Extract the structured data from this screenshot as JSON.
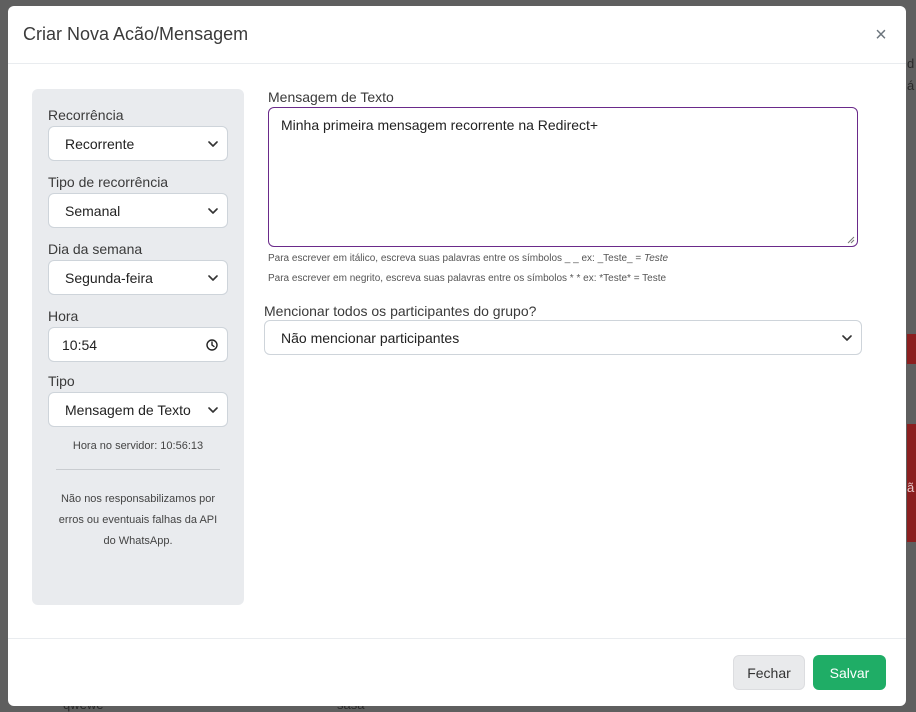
{
  "modal": {
    "title": "Criar Nova Acão/Mensagem",
    "close_symbol": "×"
  },
  "left_panel": {
    "recurrence": {
      "label": "Recorrência",
      "value": "Recorrente"
    },
    "recurrence_type": {
      "label": "Tipo de recorrência",
      "value": "Semanal"
    },
    "weekday": {
      "label": "Dia da semana",
      "value": "Segunda-feira"
    },
    "time": {
      "label": "Hora",
      "value": "10:54"
    },
    "type": {
      "label": "Tipo",
      "value": "Mensagem de Texto"
    },
    "server_time": "Hora no servidor: 10:56:13",
    "disclaimer_line1": "Não nos responsabilizamos por",
    "disclaimer_line2": "erros ou eventuais falhas da API",
    "disclaimer_line3": "do WhatsApp."
  },
  "message": {
    "label": "Mensagem de Texto",
    "value": "Minha primeira mensagem recorrente na Redirect+",
    "hint_italic_prefix": "Para escrever em itálico, escreva suas palavras entre os símbolos _ _ ex: _Teste_ = ",
    "hint_italic_example": "Teste",
    "hint_bold": "Para escrever em negrito, escreva suas palavras entre os símbolos * * ex: *Teste* = Teste"
  },
  "mention": {
    "label": "Mencionar todos os participantes do grupo?",
    "value": "Não mencionar participantes"
  },
  "footer": {
    "close_label": "Fechar",
    "save_label": "Salvar"
  },
  "background": {
    "frag1": "d",
    "frag2": "á",
    "frag3": "ã",
    "frag4": "qwewe",
    "frag5": "sasa"
  },
  "colors": {
    "save_button": "#1fad66",
    "textarea_border": "#6a2a8a",
    "panel_bg": "#e9ebee"
  }
}
